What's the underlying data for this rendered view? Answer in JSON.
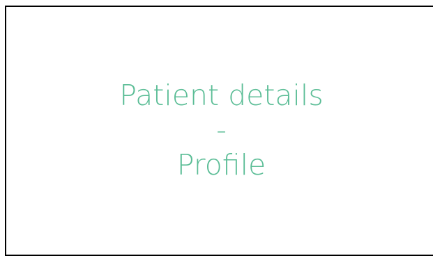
{
  "colors": {
    "title_text": "#5bbd96",
    "frame_border": "#000000",
    "background": "#ffffff"
  },
  "page": {
    "title_line1": "Patient details",
    "separator": "-",
    "title_line2": "Profile"
  }
}
